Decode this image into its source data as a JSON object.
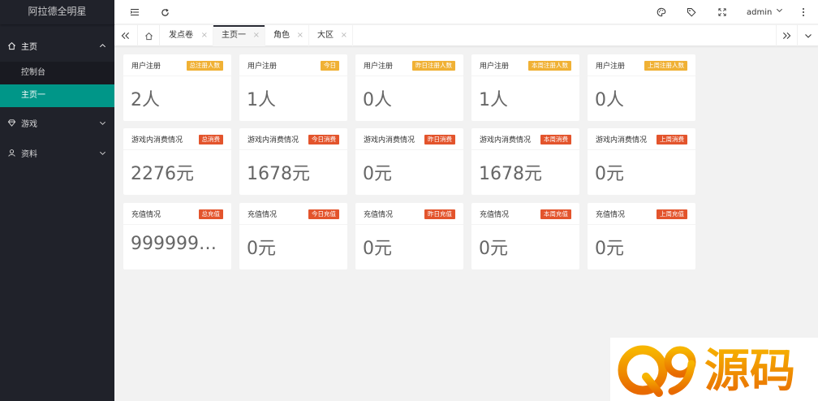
{
  "sidebar": {
    "app_title": "阿拉德全明星",
    "groups": [
      {
        "label": "主页",
        "icon": "home-icon",
        "expanded": true,
        "children": [
          {
            "label": "控制台",
            "active": false
          },
          {
            "label": "主页一",
            "active": true
          }
        ]
      },
      {
        "label": "游戏",
        "icon": "diamond-icon",
        "expanded": false
      },
      {
        "label": "资料",
        "icon": "user-icon",
        "expanded": false
      }
    ]
  },
  "header": {
    "icons": [
      "menu-fold-icon",
      "refresh-icon",
      "theme-icon",
      "tag-icon",
      "fullscreen-icon",
      "more-icon"
    ],
    "user": "admin"
  },
  "tabs": {
    "items": [
      {
        "label": "发点卷",
        "active": false
      },
      {
        "label": "主页一",
        "active": true
      },
      {
        "label": "角色",
        "active": false
      },
      {
        "label": "大区",
        "active": false
      }
    ],
    "close_glyph": "×"
  },
  "rows": [
    {
      "cards": [
        {
          "title": "用户注册",
          "badge": "总注册人数",
          "value": "2人"
        },
        {
          "title": "用户注册",
          "badge": "今日",
          "value": "1人"
        },
        {
          "title": "用户注册",
          "badge": "昨日注册人数",
          "value": "0人"
        },
        {
          "title": "用户注册",
          "badge": "本周注册人数",
          "value": "1人"
        },
        {
          "title": "用户注册",
          "badge": "上周注册人数",
          "value": "0人"
        }
      ]
    },
    {
      "cards": [
        {
          "title": "游戏内消费情况",
          "badge": "总消费",
          "value": "2276元"
        },
        {
          "title": "游戏内消费情况",
          "badge": "今日消费",
          "value": "1678元"
        },
        {
          "title": "游戏内消费情况",
          "badge": "昨日消费",
          "value": "0元"
        },
        {
          "title": "游戏内消费情况",
          "badge": "本周消费",
          "value": "1678元"
        },
        {
          "title": "游戏内消费情况",
          "badge": "上周消费",
          "value": "0元"
        }
      ]
    },
    {
      "cards": [
        {
          "title": "充值情况",
          "badge": "总充值",
          "value": "9999999…"
        },
        {
          "title": "充值情况",
          "badge": "今日充值",
          "value": "0元"
        },
        {
          "title": "充值情况",
          "badge": "昨日充值",
          "value": "0元"
        },
        {
          "title": "充值情况",
          "badge": "本周充值",
          "value": "0元"
        },
        {
          "title": "充值情况",
          "badge": "上周充值",
          "value": "0元"
        }
      ]
    }
  ],
  "colors": {
    "sidebar_bg": "#20222a",
    "active": "#009688",
    "badge_yellow": "#f0b135",
    "badge_red": "#e3542c",
    "watermark_orange": "#f39800"
  },
  "watermark": {
    "text": "Q9源码"
  }
}
